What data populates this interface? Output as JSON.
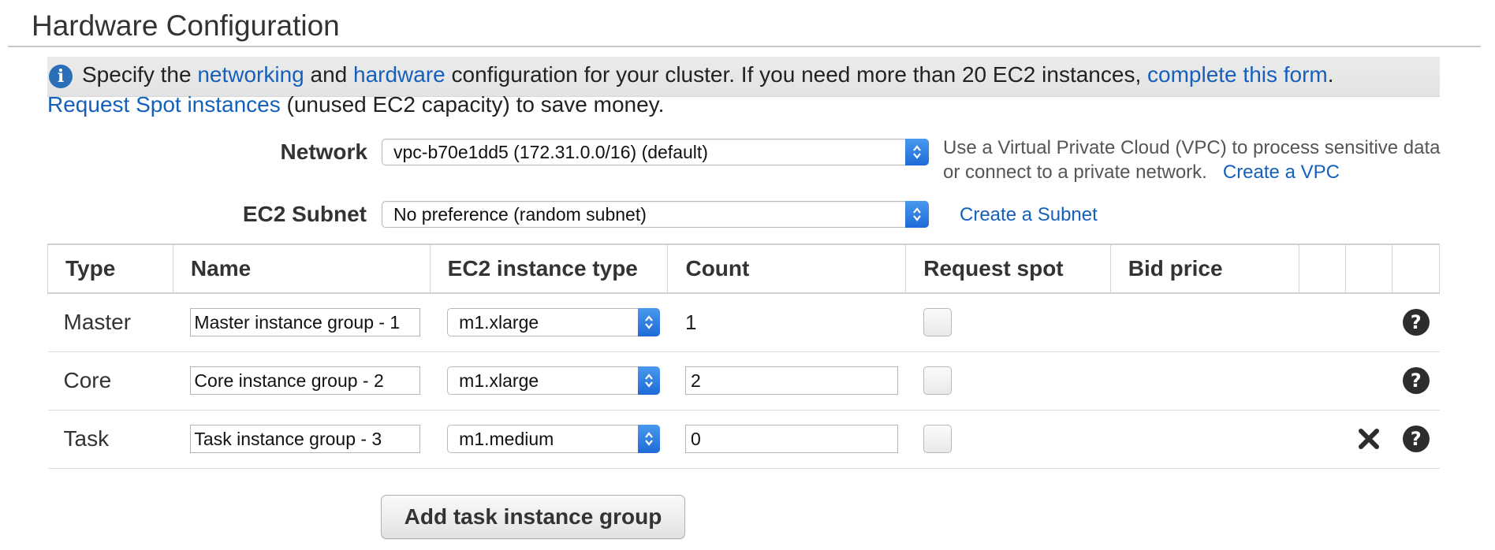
{
  "section": {
    "title": "Hardware Configuration"
  },
  "info": {
    "text_1": "Specify the",
    "link_networking": "networking",
    "text_2": "and",
    "link_hardware": "hardware",
    "text_3": "configuration for your cluster. If you need more than 20 EC2 instances,",
    "link_form": "complete this form",
    "text_4": ".",
    "link_spot": "Request Spot instances",
    "text_5": "(unused EC2 capacity) to save money."
  },
  "network": {
    "label": "Network",
    "value": "vpc-b70e1dd5 (172.31.0.0/16) (default)",
    "hint_line1": "Use a Virtual Private Cloud (VPC) to process sensitive data",
    "hint_line2": "or connect to a private network.",
    "create_vpc_link": "Create a VPC"
  },
  "subnet": {
    "label": "EC2 Subnet",
    "value": "No preference (random subnet)",
    "create_subnet_link": "Create a Subnet"
  },
  "table": {
    "headers": [
      "Type",
      "Name",
      "EC2 instance type",
      "Count",
      "Request spot",
      "Bid price",
      "",
      "",
      ""
    ],
    "rows": [
      {
        "type": "Master",
        "name": "Master instance group - 1",
        "instance_type": "m1.xlarge",
        "count": "1",
        "count_editable": false,
        "request_spot": false,
        "removable": false
      },
      {
        "type": "Core",
        "name": "Core instance group - 2",
        "instance_type": "m1.xlarge",
        "count": "2",
        "count_editable": true,
        "request_spot": false,
        "removable": false
      },
      {
        "type": "Task",
        "name": "Task instance group - 3",
        "instance_type": "m1.medium",
        "count": "0",
        "count_editable": true,
        "request_spot": false,
        "removable": true
      }
    ]
  },
  "buttons": {
    "add_task_group": "Add task instance group"
  },
  "icons": {
    "info": "info-icon",
    "help": "question-circle-icon",
    "remove": "close-x-icon",
    "select_arrow": "updown-chevron-icon"
  },
  "colors": {
    "link": "#1560bd",
    "select_arrow": "#2a78e4"
  }
}
